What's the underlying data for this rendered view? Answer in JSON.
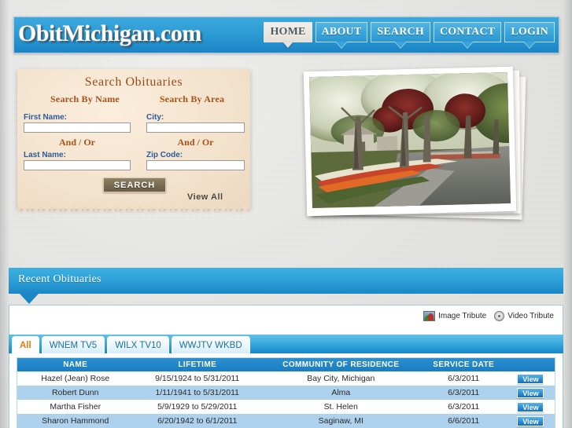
{
  "site": {
    "logo": "ObitMichigan.com"
  },
  "nav": {
    "items": [
      {
        "label": "HOME",
        "active": true
      },
      {
        "label": "ABOUT",
        "active": false
      },
      {
        "label": "SEARCH",
        "active": false
      },
      {
        "label": "CONTACT",
        "active": false
      },
      {
        "label": "LOGIN",
        "active": false
      }
    ]
  },
  "search_panel": {
    "title": "Search Obituaries",
    "subtitle_left": "Search By Name",
    "subtitle_right": "Search By Area",
    "first_name_label": "First Name:",
    "first_name_value": "",
    "last_name_label": "Last Name:",
    "last_name_value": "",
    "city_label": "City:",
    "city_value": "",
    "zip_label": "Zip Code:",
    "zip_value": "",
    "and_or_left": "And / Or",
    "and_or_right": "And / Or",
    "search_button": "SEARCH",
    "view_all": "View All"
  },
  "recent": {
    "banner_title": "Recent Obituaries",
    "image_tribute": "Image Tribute",
    "video_tribute": "Video Tribute"
  },
  "tabs": [
    {
      "label": "All",
      "active": true
    },
    {
      "label": "WNEM TV5",
      "active": false
    },
    {
      "label": "WILX TV10",
      "active": false
    },
    {
      "label": "WWJTV WKBD",
      "active": false
    }
  ],
  "table": {
    "headers": [
      "NAME",
      "LIFETIME",
      "COMMUNITY OF RESIDENCE",
      "SERVICE DATE",
      ""
    ],
    "view_label": "View",
    "rows": [
      {
        "name": "Hazel (Jean) Rose",
        "lifetime": "9/15/1924 to 5/31/2011",
        "community": "Bay City, Michigan",
        "service_date": "6/3/2011"
      },
      {
        "name": "Robert Dunn",
        "lifetime": "1/11/1941 to 5/31/2011",
        "community": "Alma",
        "service_date": "6/3/2011"
      },
      {
        "name": "Martha Fisher",
        "lifetime": "5/9/1929 to 5/29/2011",
        "community": "St. Helen",
        "service_date": "6/3/2011"
      },
      {
        "name": "Sharon Hammond",
        "lifetime": "6/20/1942 to 6/1/2011",
        "community": "Saginaw, MI",
        "service_date": "6/6/2011"
      }
    ]
  },
  "colors": {
    "brand_blue": "#2e9ed6",
    "header_dark_blue": "#1a84c4",
    "accent_orange": "#e07a10",
    "paper_cream": "#f3e2cc",
    "link_blue": "#1f6fb5",
    "row_alt_blue": "#aed1ee"
  }
}
